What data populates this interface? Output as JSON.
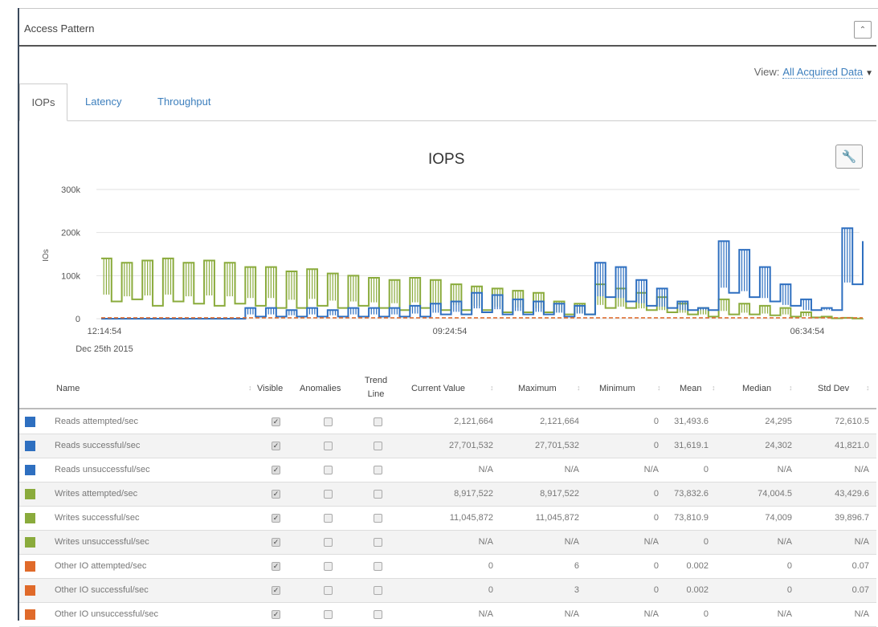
{
  "panel": {
    "title": "Access Pattern",
    "collapse_icon": "chevron-up-icon"
  },
  "view": {
    "label": "View:",
    "value": "All Acquired Data"
  },
  "tabs": [
    {
      "label": "IOPs",
      "active": true
    },
    {
      "label": "Latency",
      "active": false
    },
    {
      "label": "Throughput",
      "active": false
    }
  ],
  "chart_data": {
    "type": "line",
    "title": "IOPS",
    "ylabel": "IOs",
    "ylim": [
      0,
      300000
    ],
    "y_ticks": [
      "0",
      "100k",
      "200k",
      "300k"
    ],
    "x_ticks": [
      {
        "label": "12:14:54",
        "sublabel": "Dec 25th 2015"
      },
      {
        "label": "09:24:54",
        "sublabel": ""
      },
      {
        "label": "06:34:54",
        "sublabel": ""
      }
    ],
    "grid": true,
    "series": [
      {
        "color": "#8aab3c",
        "values": [
          140000,
          40000,
          130000,
          45000,
          135000,
          30000,
          140000,
          40000,
          130000,
          35000,
          135000,
          30000,
          130000,
          35000,
          120000,
          30000,
          120000,
          25000,
          110000,
          25000,
          115000,
          30000,
          105000,
          25000,
          100000,
          30000,
          95000,
          25000,
          90000,
          20000,
          95000,
          25000,
          90000,
          20000,
          80000,
          20000,
          75000,
          20000,
          70000,
          15000,
          65000,
          15000,
          60000,
          15000,
          40000,
          10000,
          35000,
          10000,
          80000,
          25000,
          70000,
          25000,
          60000,
          20000,
          50000,
          15000,
          35000,
          10000,
          25000,
          5000,
          45000,
          10000,
          35000,
          10000,
          30000,
          8000,
          25000,
          5000,
          15000,
          3000,
          5000,
          1000,
          2000,
          500,
          1000
        ]
      },
      {
        "color": "#2e6fc0",
        "values": [
          0,
          0,
          0,
          0,
          0,
          0,
          0,
          0,
          0,
          0,
          0,
          0,
          0,
          0,
          25000,
          5000,
          25000,
          5000,
          20000,
          5000,
          25000,
          5000,
          20000,
          5000,
          25000,
          5000,
          25000,
          5000,
          25000,
          5000,
          30000,
          5000,
          35000,
          10000,
          40000,
          10000,
          60000,
          15000,
          55000,
          10000,
          45000,
          10000,
          40000,
          10000,
          35000,
          5000,
          30000,
          10000,
          130000,
          50000,
          120000,
          40000,
          90000,
          30000,
          70000,
          25000,
          40000,
          20000,
          25000,
          20000,
          180000,
          60000,
          160000,
          50000,
          120000,
          40000,
          80000,
          30000,
          45000,
          20000,
          25000,
          20000,
          210000,
          80000,
          180000
        ]
      },
      {
        "color": "#e06a2a",
        "values": [
          2000,
          2000,
          2000,
          2000,
          2000,
          2000,
          2000,
          2000,
          2000,
          2000,
          2000,
          2000,
          2000,
          2000,
          2000,
          2000,
          2000,
          2000,
          2000,
          2000,
          2000,
          2000,
          2000,
          2000,
          2000,
          2000,
          2000,
          2000,
          2000,
          2000,
          2000,
          2000,
          2000,
          2000,
          2000,
          2000,
          2000,
          2000,
          2000,
          2000,
          2000,
          2000,
          2000,
          2000,
          2000,
          2000,
          2000,
          2000,
          2000,
          2000,
          2000,
          2000,
          2000,
          2000,
          2000,
          2000,
          2000,
          2000,
          2000,
          2000,
          2000,
          2000,
          2000,
          2000,
          2000,
          2000,
          2000,
          2000,
          2000,
          2000,
          2000,
          2000,
          2000,
          2000,
          2000
        ]
      }
    ]
  },
  "table": {
    "headers": [
      "Name",
      "Visible",
      "Anomalies",
      "Trend Line",
      "Current Value",
      "Maximum",
      "Minimum",
      "Mean",
      "Median",
      "Std Dev"
    ],
    "rows": [
      {
        "color": "#2e6fc0",
        "name": "Reads attempted/sec",
        "visible": true,
        "current": "2,121,664",
        "max": "2,121,664",
        "min": "0",
        "mean": "31,493.6",
        "median": "24,295",
        "std": "72,610.5"
      },
      {
        "color": "#2e6fc0",
        "name": "Reads successful/sec",
        "visible": true,
        "current": "27,701,532",
        "max": "27,701,532",
        "min": "0",
        "mean": "31,619.1",
        "median": "24,302",
        "std": "41,821.0"
      },
      {
        "color": "#2e6fc0",
        "name": "Reads unsuccessful/sec",
        "visible": true,
        "current": "N/A",
        "max": "N/A",
        "min": "N/A",
        "mean": "0",
        "median": "N/A",
        "std": "N/A"
      },
      {
        "color": "#8aab3c",
        "name": "Writes attempted/sec",
        "visible": true,
        "current": "8,917,522",
        "max": "8,917,522",
        "min": "0",
        "mean": "73,832.6",
        "median": "74,004.5",
        "std": "43,429.6"
      },
      {
        "color": "#8aab3c",
        "name": "Writes successful/sec",
        "visible": true,
        "current": "11,045,872",
        "max": "11,045,872",
        "min": "0",
        "mean": "73,810.9",
        "median": "74,009",
        "std": "39,896.7"
      },
      {
        "color": "#8aab3c",
        "name": "Writes unsuccessful/sec",
        "visible": true,
        "current": "N/A",
        "max": "N/A",
        "min": "N/A",
        "mean": "0",
        "median": "N/A",
        "std": "N/A"
      },
      {
        "color": "#e06a2a",
        "name": "Other IO attempted/sec",
        "visible": true,
        "current": "0",
        "max": "6",
        "min": "0",
        "mean": "0.002",
        "median": "0",
        "std": "0.07"
      },
      {
        "color": "#e06a2a",
        "name": "Other IO successful/sec",
        "visible": true,
        "current": "0",
        "max": "3",
        "min": "0",
        "mean": "0.002",
        "median": "0",
        "std": "0.07"
      },
      {
        "color": "#e06a2a",
        "name": "Other IO unsuccessful/sec",
        "visible": true,
        "current": "N/A",
        "max": "N/A",
        "min": "N/A",
        "mean": "0",
        "median": "N/A",
        "std": "N/A"
      }
    ]
  }
}
